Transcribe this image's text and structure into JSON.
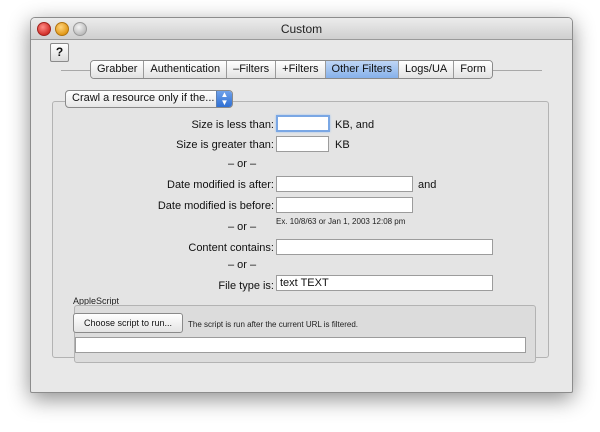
{
  "window": {
    "title": "Custom"
  },
  "help_button": {
    "label": "?"
  },
  "tabs": [
    {
      "label": "Grabber",
      "selected": false
    },
    {
      "label": "Authentication",
      "selected": false
    },
    {
      "label": "–Filters",
      "selected": false
    },
    {
      "label": "+Filters",
      "selected": false
    },
    {
      "label": "Other Filters",
      "selected": true
    },
    {
      "label": "Logs/UA",
      "selected": false
    },
    {
      "label": "Form",
      "selected": false
    }
  ],
  "crawl_popup": {
    "selected": "Crawl a resource only if the..."
  },
  "filters": {
    "size_less_label": "Size is less than:",
    "size_less_value": "",
    "size_less_unit": "KB, and",
    "size_greater_label": "Size is greater than:",
    "size_greater_value": "",
    "size_greater_unit": "KB",
    "or_1": "– or –",
    "date_after_label": "Date modified is after:",
    "date_after_value": "",
    "date_after_suffix": "and",
    "date_before_label": "Date modified is before:",
    "date_before_value": "",
    "or_2": "– or –",
    "date_example": "Ex. 10/8/63 or Jan 1, 2003 12:08 pm",
    "content_label": "Content contains:",
    "content_value": "",
    "or_3": "– or –",
    "filetype_label": "File type is:",
    "filetype_value": "text TEXT"
  },
  "applescript": {
    "section_label": "AppleScript",
    "choose_button": "Choose script to run...",
    "note": "The script is run after the current URL is filtered.",
    "path_value": ""
  }
}
